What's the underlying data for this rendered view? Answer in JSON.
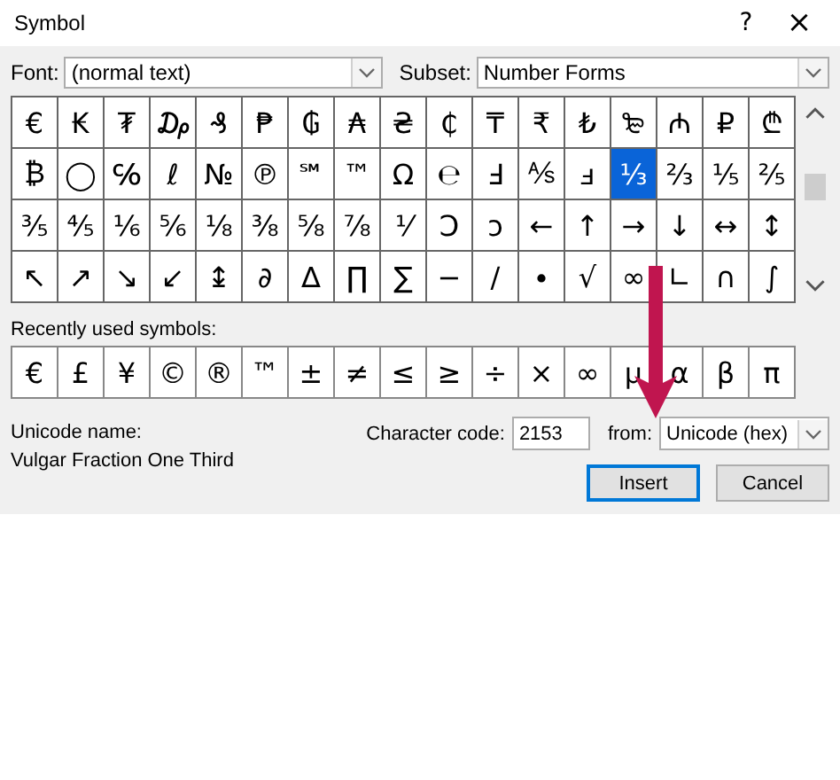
{
  "window": {
    "title": "Symbol",
    "help": "?",
    "close": "×"
  },
  "font": {
    "label": "Font:",
    "value": "(normal text)"
  },
  "subset": {
    "label": "Subset:",
    "value": "Number Forms"
  },
  "symbols": [
    {
      "symbol": "€",
      "selected": false
    },
    {
      "symbol": "₭",
      "selected": false
    },
    {
      "symbol": "₮",
      "selected": false
    },
    {
      "symbol": "₯",
      "selected": false
    },
    {
      "symbol": "₰",
      "selected": false
    },
    {
      "symbol": "₱",
      "selected": false
    },
    {
      "symbol": "₲",
      "selected": false
    },
    {
      "symbol": "₳",
      "selected": false
    },
    {
      "symbol": "₴",
      "selected": false
    },
    {
      "symbol": "₵",
      "selected": false
    },
    {
      "symbol": "₸",
      "selected": false
    },
    {
      "symbol": "₹",
      "selected": false
    },
    {
      "symbol": "₺",
      "selected": false
    },
    {
      "symbol": "₻",
      "selected": false
    },
    {
      "symbol": "₼",
      "selected": false
    },
    {
      "symbol": "₽",
      "selected": false
    },
    {
      "symbol": "₾",
      "selected": false
    },
    {
      "symbol": "₿",
      "selected": false
    },
    {
      "symbol": "◯",
      "selected": false
    },
    {
      "symbol": "℅",
      "selected": false
    },
    {
      "symbol": "ℓ",
      "selected": false
    },
    {
      "symbol": "№",
      "selected": false
    },
    {
      "symbol": "℗",
      "selected": false
    },
    {
      "symbol": "℠",
      "selected": false
    },
    {
      "symbol": "™",
      "selected": false
    },
    {
      "symbol": "Ω",
      "selected": false
    },
    {
      "symbol": "℮",
      "selected": false
    },
    {
      "symbol": "Ⅎ",
      "selected": false
    },
    {
      "symbol": "⅍",
      "selected": false
    },
    {
      "symbol": "ⅎ",
      "selected": false
    },
    {
      "symbol": "⅓",
      "selected": true
    },
    {
      "symbol": "⅔",
      "selected": false
    },
    {
      "symbol": "⅕",
      "selected": false
    },
    {
      "symbol": "⅖",
      "selected": false
    },
    {
      "symbol": "⅗",
      "selected": false
    },
    {
      "symbol": "⅘",
      "selected": false
    },
    {
      "symbol": "⅙",
      "selected": false
    },
    {
      "symbol": "⅚",
      "selected": false
    },
    {
      "symbol": "⅛",
      "selected": false
    },
    {
      "symbol": "⅜",
      "selected": false
    },
    {
      "symbol": "⅝",
      "selected": false
    },
    {
      "symbol": "⅞",
      "selected": false
    },
    {
      "symbol": "⅟",
      "selected": false
    },
    {
      "symbol": "Ↄ",
      "selected": false
    },
    {
      "symbol": "ↄ",
      "selected": false
    },
    {
      "symbol": "←",
      "selected": false
    },
    {
      "symbol": "↑",
      "selected": false
    },
    {
      "symbol": "→",
      "selected": false
    },
    {
      "symbol": "↓",
      "selected": false
    },
    {
      "symbol": "↔",
      "selected": false
    },
    {
      "symbol": "↕",
      "selected": false
    },
    {
      "symbol": "↖",
      "selected": false
    },
    {
      "symbol": "↗",
      "selected": false
    },
    {
      "symbol": "↘",
      "selected": false
    },
    {
      "symbol": "↙",
      "selected": false
    },
    {
      "symbol": "↨",
      "selected": false
    },
    {
      "symbol": "∂",
      "selected": false
    },
    {
      "symbol": "∆",
      "selected": false
    },
    {
      "symbol": "∏",
      "selected": false
    },
    {
      "symbol": "∑",
      "selected": false
    },
    {
      "symbol": "−",
      "selected": false
    },
    {
      "symbol": "∕",
      "selected": false
    },
    {
      "symbol": "∙",
      "selected": false
    },
    {
      "symbol": "√",
      "selected": false
    },
    {
      "symbol": "∞",
      "selected": false
    },
    {
      "symbol": "∟",
      "selected": false
    },
    {
      "symbol": "∩",
      "selected": false
    },
    {
      "symbol": "∫",
      "selected": false
    }
  ],
  "recent": {
    "label": "Recently used symbols:",
    "symbols": [
      "€",
      "£",
      "¥",
      "©",
      "®",
      "™",
      "±",
      "≠",
      "≤",
      "≥",
      "÷",
      "×",
      "∞",
      "µ",
      "α",
      "β",
      "π"
    ]
  },
  "unicode_name": {
    "label": "Unicode name:",
    "value": "Vulgar Fraction One Third"
  },
  "character_code": {
    "label": "Character code:",
    "value": "2153"
  },
  "from": {
    "label": "from:",
    "value": "Unicode (hex)"
  },
  "buttons": [
    {
      "label": "Insert",
      "default": true
    },
    {
      "label": "Cancel",
      "default": false
    }
  ]
}
